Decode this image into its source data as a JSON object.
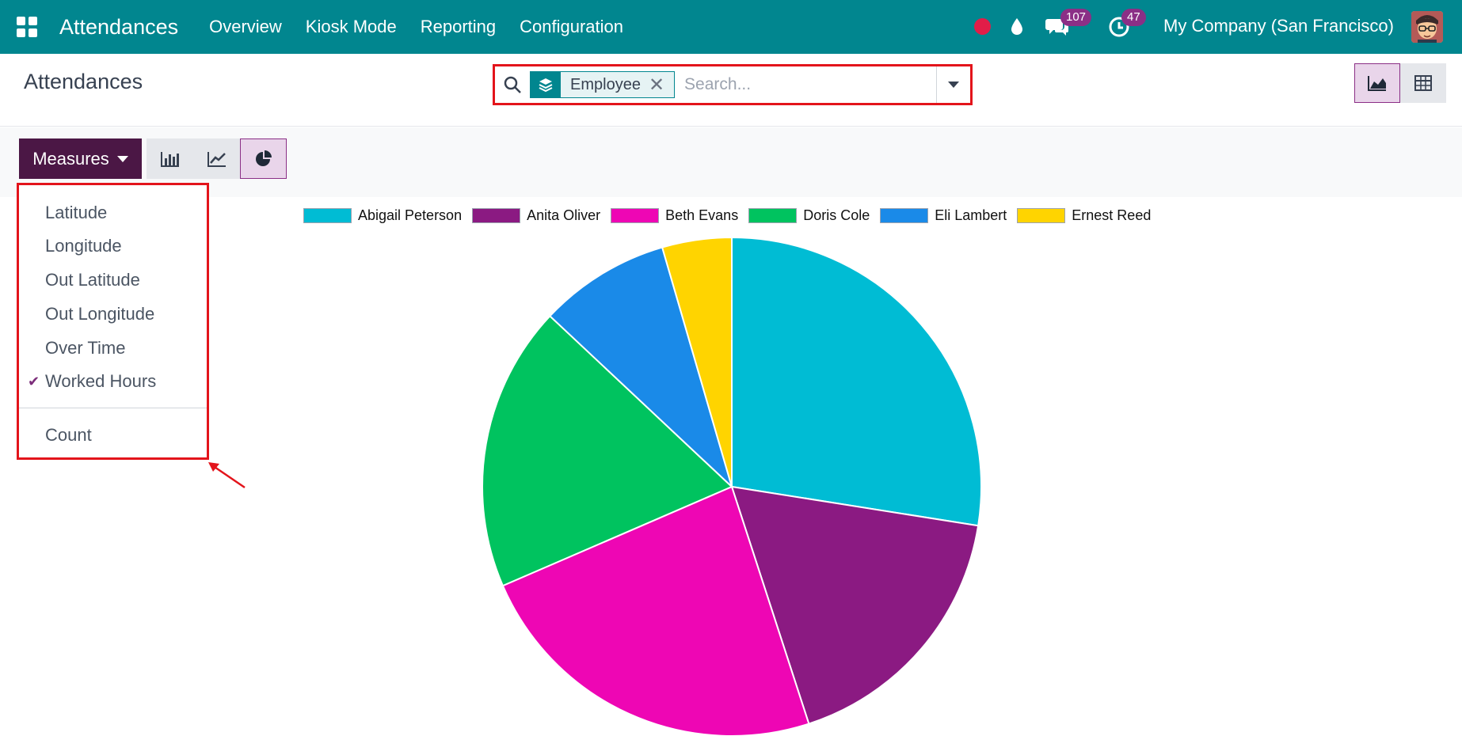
{
  "navbar": {
    "app_title": "Attendances",
    "menu": [
      "Overview",
      "Kiosk Mode",
      "Reporting",
      "Configuration"
    ],
    "messages_count": "107",
    "activities_count": "47",
    "company": "My Company (San Francisco)"
  },
  "control_panel": {
    "breadcrumb": "Attendances",
    "search": {
      "facet_label": "Employee",
      "placeholder": "Search..."
    }
  },
  "toolbar": {
    "measures_label": "Measures"
  },
  "measures_menu": {
    "items": [
      {
        "label": "Latitude",
        "checked": false
      },
      {
        "label": "Longitude",
        "checked": false
      },
      {
        "label": "Out Latitude",
        "checked": false
      },
      {
        "label": "Out Longitude",
        "checked": false
      },
      {
        "label": "Over Time",
        "checked": false
      },
      {
        "label": "Worked Hours",
        "checked": true
      }
    ],
    "count_label": "Count"
  },
  "chart_data": {
    "type": "pie",
    "categories": [
      "Abigail Peterson",
      "Anita Oliver",
      "Beth Evans",
      "Doris Cole",
      "Eli Lambert",
      "Ernest Reed"
    ],
    "values": [
      27.5,
      17.5,
      23.5,
      18.5,
      8.5,
      4.5
    ],
    "colors": [
      "#00bcd4",
      "#8b1a82",
      "#ee06b4",
      "#00c35f",
      "#1a8ae8",
      "#ffd400"
    ],
    "legend_position": "top"
  }
}
